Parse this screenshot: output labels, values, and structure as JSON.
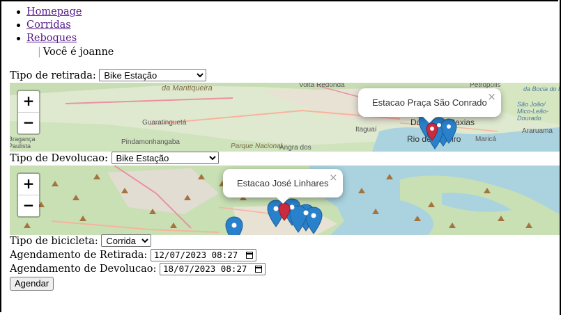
{
  "nav": {
    "items": [
      "Homepage",
      "Corridas",
      "Reboques"
    ],
    "user_text": "Você é joanne"
  },
  "pickup": {
    "label": "Tipo de retirada:",
    "selected": "Bike Estação",
    "map": {
      "popup_text": "Estacao Praça São Conrado",
      "close_label": "×",
      "zoom_in": "+",
      "zoom_out": "−",
      "labels": [
        "da Mantiqueira",
        "Guaratinguetá",
        "Pindamonhangaba",
        "Volta Redonda",
        "Itaguaí",
        "Duque de Caxias",
        "Rio de Janeiro",
        "Maricá",
        "Araruama",
        "Petrópolis",
        "Parque Nacional",
        "Angra dos",
        "da Bocia do Rio",
        "São João/ Mico-Leão-Dourado",
        "Bragança Paulista"
      ]
    }
  },
  "dropoff": {
    "label": "Tipo de Devolucao:",
    "selected": "Bike Estação",
    "map": {
      "popup_text": "Estacao José Linhares",
      "close_label": "×",
      "zoom_in": "+",
      "zoom_out": "−"
    }
  },
  "bike_type": {
    "label": "Tipo de bicicleta:",
    "selected": "Corrida"
  },
  "schedule_pickup": {
    "label": "Agendamento de Retirada:",
    "value": "12/07/2023 08:27"
  },
  "schedule_return": {
    "label": "Agendamento de Devolucao:",
    "value": "18/07/2023 08:27"
  },
  "submit_label": "Agendar",
  "colors": {
    "link": "#551a8b",
    "marker_blue": "#2a81cb",
    "marker_red": "#cb2b3e",
    "water": "#aad3df",
    "forest": "#c8e0b4"
  }
}
